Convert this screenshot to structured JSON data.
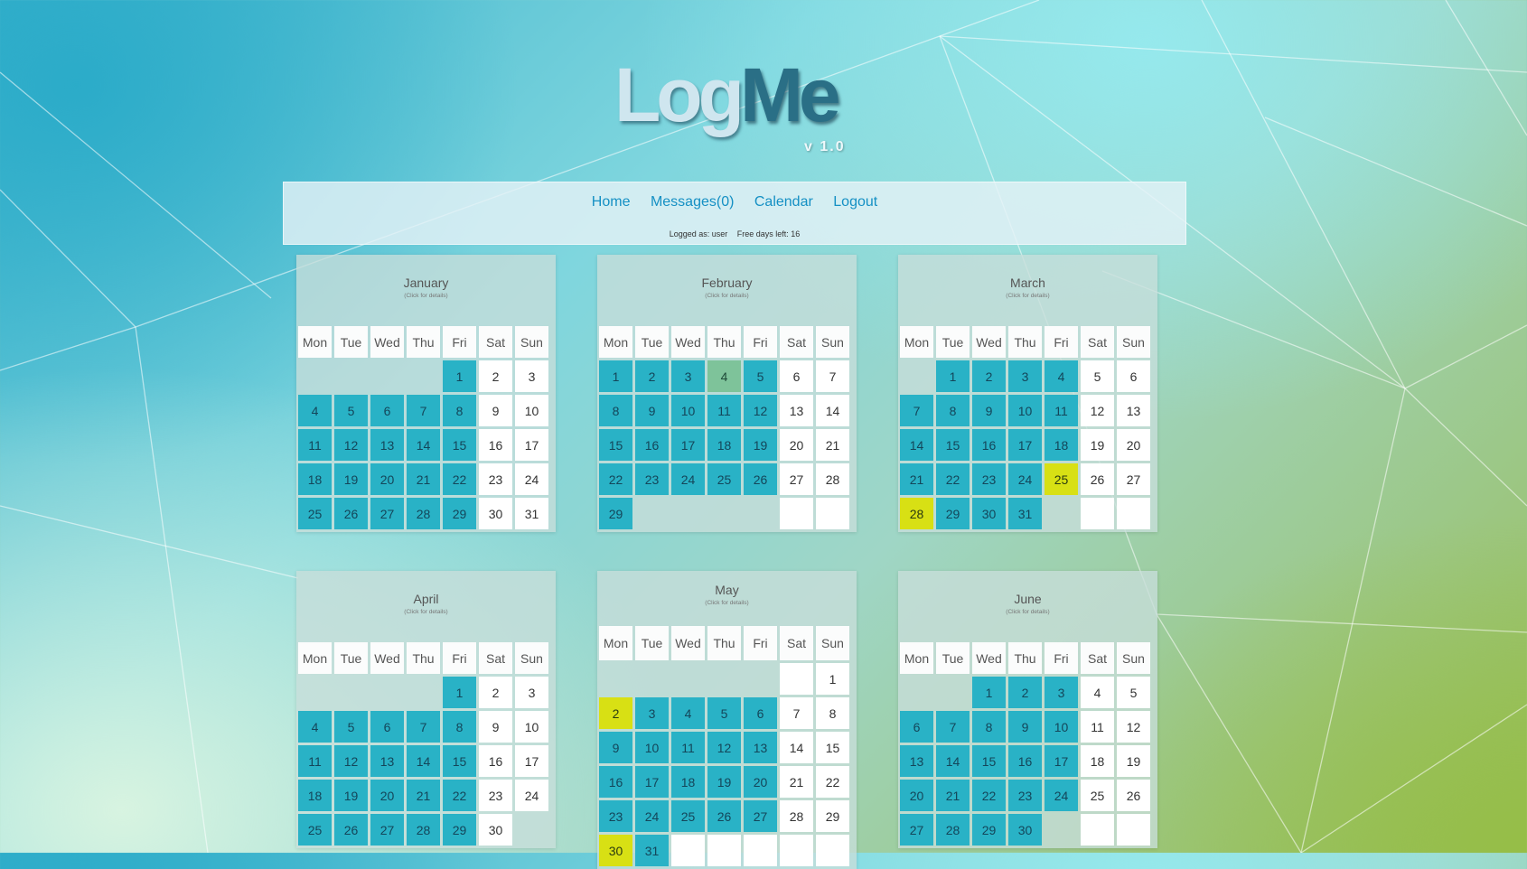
{
  "logo": {
    "part1": "Log",
    "part2": "Me",
    "version": "v 1.0"
  },
  "nav": {
    "home": "Home",
    "messages": "Messages(0)",
    "calendar": "Calendar",
    "logout": "Logout"
  },
  "user": {
    "logged": "Logged as: user",
    "free_days": "Free days left: 16"
  },
  "weekdays": [
    "Mon",
    "Tue",
    "Wed",
    "Thu",
    "Fri",
    "Sat",
    "Sun"
  ],
  "colors": {
    "workday": "#29b2c6",
    "weekend": "#ffffff",
    "marked": "#d8e014",
    "selected": "#7ec39a"
  },
  "months": [
    {
      "name": "January",
      "sub": "(Click for details)",
      "offset": 4,
      "days": 31,
      "marked": [],
      "selected": [],
      "trailing_white": []
    },
    {
      "name": "February",
      "sub": "(Click for details)",
      "offset": 0,
      "days": 29,
      "marked": [],
      "selected": [
        4
      ],
      "trailing_white": [
        5,
        6
      ]
    },
    {
      "name": "March",
      "sub": "(Click for details)",
      "offset": 1,
      "days": 31,
      "marked": [
        25,
        28
      ],
      "selected": [],
      "trailing_white": [
        5,
        6
      ]
    },
    {
      "name": "April",
      "sub": "(Click for details)",
      "offset": 4,
      "days": 30,
      "marked": [],
      "selected": [],
      "trailing_white": []
    },
    {
      "name": "May",
      "sub": "(Click for details)",
      "offset": 6,
      "days": 31,
      "marked": [
        2,
        30
      ],
      "selected": [],
      "trailing_white": [
        2,
        3,
        4,
        5,
        6
      ]
    },
    {
      "name": "June",
      "sub": "(Click for details)",
      "offset": 2,
      "days": 30,
      "marked": [],
      "selected": [],
      "trailing_white": [
        5,
        6
      ]
    }
  ]
}
